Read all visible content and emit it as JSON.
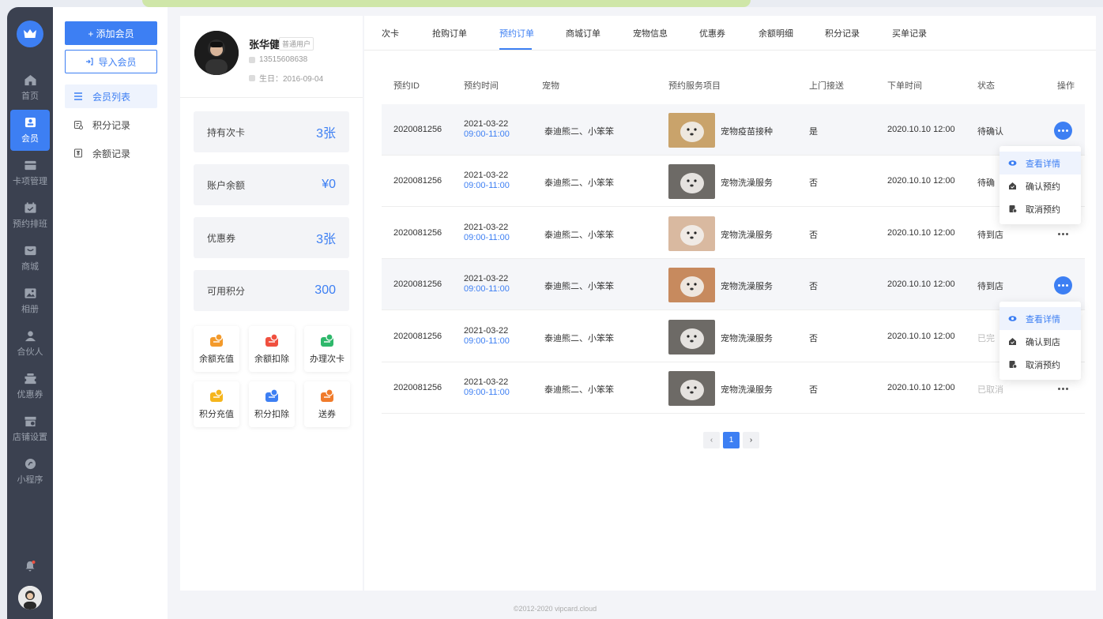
{
  "rail": {
    "items": [
      {
        "label": "首页",
        "icon": "home-icon"
      },
      {
        "label": "会员",
        "icon": "member-icon",
        "active": true
      },
      {
        "label": "卡项管理",
        "icon": "card-icon"
      },
      {
        "label": "预约排班",
        "icon": "calendar-icon"
      },
      {
        "label": "商城",
        "icon": "mall-icon"
      },
      {
        "label": "相册",
        "icon": "album-icon"
      },
      {
        "label": "合伙人",
        "icon": "partner-icon"
      },
      {
        "label": "优惠券",
        "icon": "coupon-icon"
      },
      {
        "label": "店铺设置",
        "icon": "store-icon"
      },
      {
        "label": "小程序",
        "icon": "miniapp-icon"
      }
    ]
  },
  "sidebar": {
    "add_button": "+ 添加会员",
    "import_button": "导入会员",
    "items": [
      {
        "label": "会员列表",
        "active": true
      },
      {
        "label": "积分记录"
      },
      {
        "label": "余额记录"
      }
    ]
  },
  "profile": {
    "name": "张华健",
    "tag": "普通用户",
    "phone": "13515608638",
    "birthday": "生日：2016-09-04",
    "stats": [
      {
        "label": "持有次卡",
        "value": "3张"
      },
      {
        "label": "账户余额",
        "value": "¥0"
      },
      {
        "label": "优惠券",
        "value": "3张"
      },
      {
        "label": "可用积分",
        "value": "300"
      }
    ],
    "actions": [
      {
        "label": "余额充值",
        "icon": "balance-recharge-icon",
        "color": "#f39a2b"
      },
      {
        "label": "余额扣除",
        "icon": "balance-deduct-icon",
        "color": "#f0503f"
      },
      {
        "label": "办理次卡",
        "icon": "issue-card-icon",
        "color": "#2eb86b"
      },
      {
        "label": "积分充值",
        "icon": "points-recharge-icon",
        "color": "#f5b51c"
      },
      {
        "label": "积分扣除",
        "icon": "points-deduct-icon",
        "color": "#3d7ff3"
      },
      {
        "label": "送券",
        "icon": "send-coupon-icon",
        "color": "#f07b2b"
      }
    ]
  },
  "tabs": [
    {
      "label": "次卡"
    },
    {
      "label": "抢购订单"
    },
    {
      "label": "预约订单",
      "active": true
    },
    {
      "label": "商城订单"
    },
    {
      "label": "宠物信息"
    },
    {
      "label": "优惠券"
    },
    {
      "label": "余额明细"
    },
    {
      "label": "积分记录"
    },
    {
      "label": "买单记录"
    }
  ],
  "table": {
    "headers": [
      "预约ID",
      "预约时间",
      "宠物",
      "预约服务项目",
      "上门接送",
      "下单时间",
      "状态",
      "操作"
    ],
    "rows": [
      {
        "id": "2020081256",
        "date": "2021-03-22",
        "time": "09:00-11:00",
        "pet": "泰迪熊二、小笨笨",
        "service": "宠物疫苗接种",
        "pickup": "是",
        "order_time": "2020.10.10 12:00",
        "status": "待确认",
        "muted": false,
        "highlight": true,
        "thumb": "#c9a36b"
      },
      {
        "id": "2020081256",
        "date": "2021-03-22",
        "time": "09:00-11:00",
        "pet": "泰迪熊二、小笨笨",
        "service": "宠物洗澡服务",
        "pickup": "否",
        "order_time": "2020.10.10 12:00",
        "status": "待确",
        "muted": false,
        "highlight": false,
        "thumb": "#6d6a66"
      },
      {
        "id": "2020081256",
        "date": "2021-03-22",
        "time": "09:00-11:00",
        "pet": "泰迪熊二、小笨笨",
        "service": "宠物洗澡服务",
        "pickup": "否",
        "order_time": "2020.10.10 12:00",
        "status": "待到店",
        "muted": false,
        "highlight": false,
        "thumb": "#d9b9a0"
      },
      {
        "id": "2020081256",
        "date": "2021-03-22",
        "time": "09:00-11:00",
        "pet": "泰迪熊二、小笨笨",
        "service": "宠物洗澡服务",
        "pickup": "否",
        "order_time": "2020.10.10 12:00",
        "status": "待到店",
        "muted": false,
        "highlight": true,
        "thumb": "#c78a5e"
      },
      {
        "id": "2020081256",
        "date": "2021-03-22",
        "time": "09:00-11:00",
        "pet": "泰迪熊二、小笨笨",
        "service": "宠物洗澡服务",
        "pickup": "否",
        "order_time": "2020.10.10 12:00",
        "status": "已完",
        "muted": true,
        "highlight": false,
        "thumb": "#6d6a66"
      },
      {
        "id": "2020081256",
        "date": "2021-03-22",
        "time": "09:00-11:00",
        "pet": "泰迪熊二、小笨笨",
        "service": "宠物洗澡服务",
        "pickup": "否",
        "order_time": "2020.10.10 12:00",
        "status": "已取消",
        "muted": true,
        "highlight": false,
        "thumb": "#6d6a66"
      }
    ]
  },
  "menus": [
    {
      "items": [
        "查看详情",
        "确认预约",
        "取消预约"
      ]
    },
    {
      "items": [
        "查看详情",
        "确认到店",
        "取消预约"
      ]
    }
  ],
  "pagination": {
    "prev": "‹",
    "current": "1",
    "next": "›"
  },
  "footer": "©2012-2020 vipcard.cloud",
  "colors": {
    "accent": "#3d7ff3",
    "rail": "#3b4150"
  }
}
